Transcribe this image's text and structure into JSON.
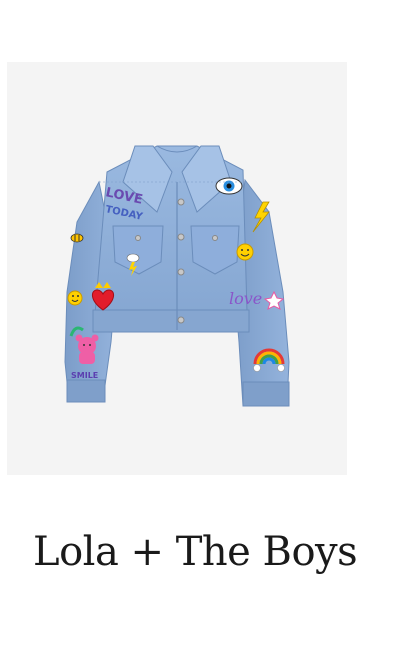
{
  "product": {
    "brand_name": "Lola + The Boys",
    "image_alt": "Cropped denim jacket with colorful patches"
  },
  "patches": {
    "love_today_top": "LOVE",
    "love_today_bottom": "TODAY",
    "smile_text": "SMILE",
    "love_script": "love"
  },
  "colors": {
    "background": "#ffffff",
    "image_bg": "#f4f4f4",
    "denim": "#8fb0d8",
    "denim_dark": "#6f93c0",
    "title": "#1a1a1a"
  }
}
